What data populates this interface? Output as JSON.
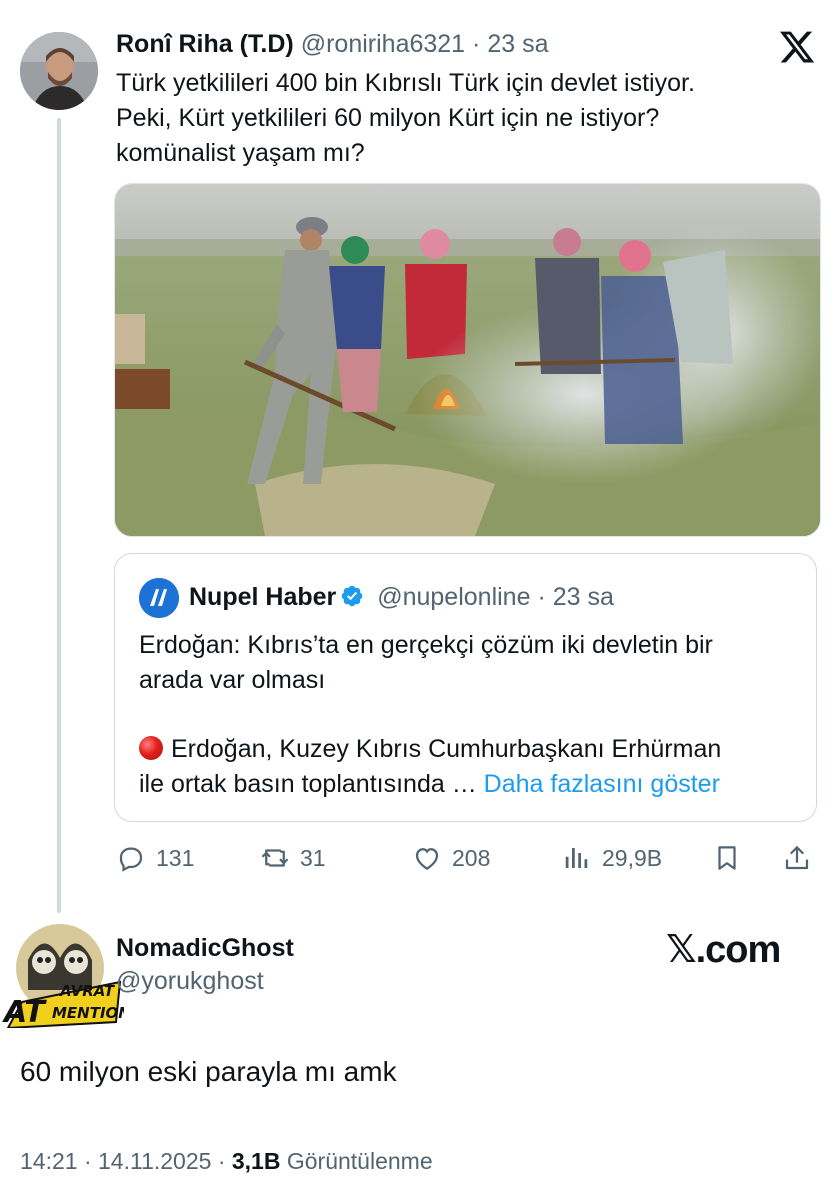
{
  "tweet": {
    "display_name": "Ronî Riha (T.D)",
    "handle": "@roniriha6321",
    "separator": "·",
    "time": "23 sa",
    "text_lines": [
      "Türk yetkilileri 400 bin Kıbrıslı Türk için devlet istiyor.",
      "Peki, Kürt yetkilileri 60 milyon Kürt için ne istiyor?",
      "komünalist yaşam mı?"
    ]
  },
  "quote": {
    "display_name": "Nupel Haber",
    "handle": "@nupelonline",
    "separator": "·",
    "time": "23 sa",
    "headline_lines": [
      "Erdoğan: Kıbrıs’ta en gerçekçi çözüm iki devletin bir",
      "arada var olması"
    ],
    "body_line1": "Erdoğan, Kuzey Kıbrıs Cumhurbaşkanı Erhürman",
    "body_line2": "ile ortak basın toplantısında …",
    "show_more": "Daha fazlasını göster"
  },
  "actions": {
    "replies": "131",
    "reposts": "31",
    "likes": "208",
    "views": "29,9B"
  },
  "reply": {
    "display_name": "NomadicGhost",
    "handle": "@yorukghost",
    "badge_text_top": "AVRAT",
    "badge_text_left": "AT",
    "badge_text_bottom": "MENTION",
    "watermark": "𝕏.com",
    "text": "60 milyon eski parayla mı amk",
    "time": "14:21",
    "separator": "·",
    "date": "14.11.2025",
    "views_count": "3,1B",
    "views_label": "Görüntülenme"
  },
  "colors": {
    "text_primary": "#0f1419",
    "text_secondary": "#536471",
    "link": "#1d9bf0",
    "border": "#cfd9de",
    "verified": "#1d9bf0"
  },
  "icons": [
    "x-logo-icon",
    "verified-badge-icon",
    "reply-icon",
    "repost-icon",
    "like-icon",
    "views-icon",
    "bookmark-icon",
    "share-icon",
    "red-circle-icon"
  ]
}
